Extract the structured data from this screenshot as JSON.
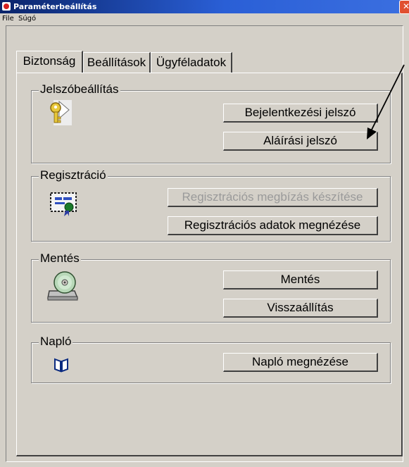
{
  "window": {
    "title": "Paraméterbeállítás",
    "close_glyph": "✕"
  },
  "menu": {
    "items": [
      "File",
      "Súgó"
    ]
  },
  "tabs": [
    {
      "label": "Biztonság",
      "active": true
    },
    {
      "label": "Beállítások",
      "active": false
    },
    {
      "label": "Ügyféladatok",
      "active": false
    }
  ],
  "groups": {
    "password": {
      "title": "Jelszóbeállítás",
      "icon": "key-icon",
      "buttons": [
        "Bejelentkezési jelszó",
        "Aláírási jelszó"
      ]
    },
    "registration": {
      "title": "Regisztráció",
      "icon": "certificate-icon",
      "buttons": [
        "Regisztrációs megbízás készítése",
        "Regisztrációs adatok megnézése"
      ],
      "disabled": [
        true,
        false
      ]
    },
    "backup": {
      "title": "Mentés",
      "icon": "disc-drive-icon",
      "buttons": [
        "Mentés",
        "Visszaállítás"
      ]
    },
    "log": {
      "title": "Napló",
      "icon": "book-icon",
      "buttons": [
        "Napló megnézése"
      ]
    }
  },
  "colors": {
    "face": "#d4d0c8",
    "title_start": "#0a246a",
    "title_end": "#3b6fe0",
    "disabled_text": "#9a9a9a"
  }
}
